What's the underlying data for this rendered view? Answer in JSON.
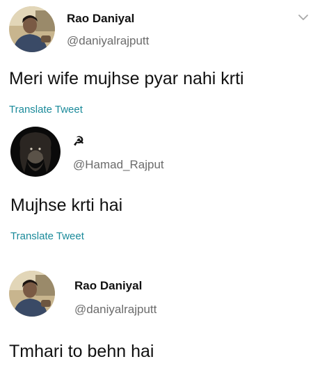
{
  "tweets": [
    {
      "display_name": "Rao Daniyal",
      "handle": "@daniyalrajputt",
      "text": "Meri wife mujhse pyar nahi krti",
      "translate_label": "Translate Tweet"
    },
    {
      "display_name": "☭",
      "handle": "@Hamad_Rajput",
      "text": "Mujhse krti hai",
      "translate_label": "Translate Tweet"
    },
    {
      "display_name": "Rao Daniyal",
      "handle": "@daniyalrajputt",
      "text": "Tmhari to behn hai"
    }
  ],
  "icons": {
    "menu": "chevron-down-icon",
    "name_symbol": "hammer-sickle-icon"
  },
  "colors": {
    "link": "#1a8a9a",
    "handle": "#6b6b6b",
    "text": "#111111"
  }
}
